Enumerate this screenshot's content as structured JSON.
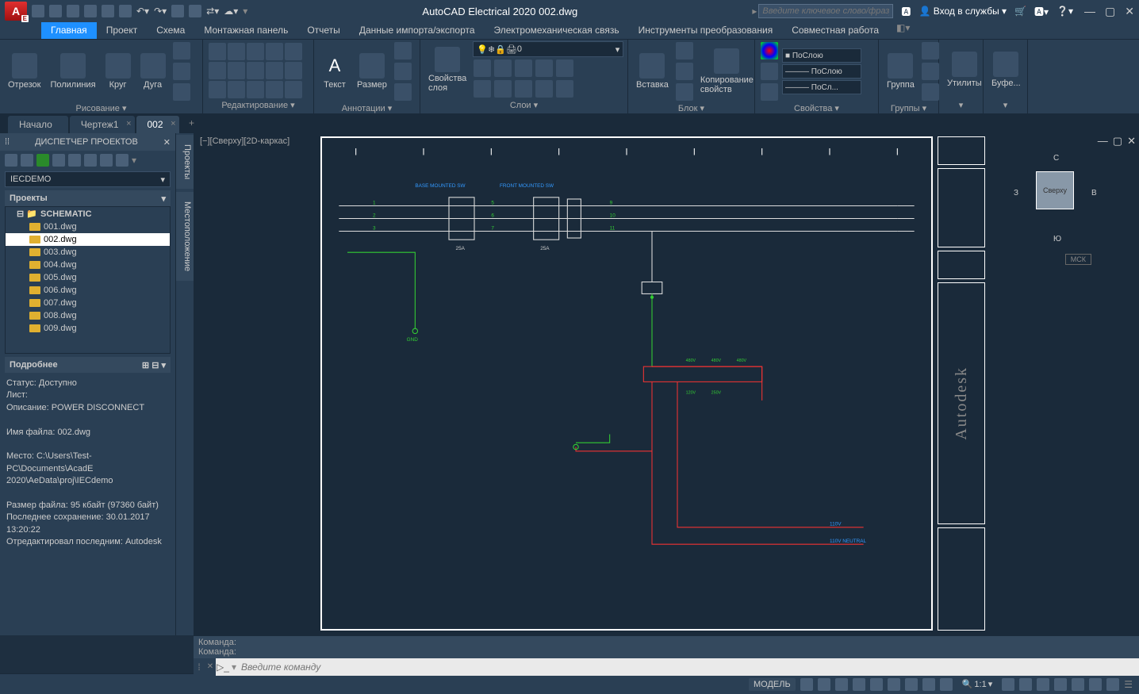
{
  "title": "AutoCAD Electrical 2020   002.dwg",
  "search_placeholder": "Введите ключевое слово/фразу",
  "signin": "Вход в службы",
  "ribbon_tabs": [
    "Главная",
    "Проект",
    "Схема",
    "Монтажная панель",
    "Отчеты",
    "Данные импорта/экспорта",
    "Электромеханическая связь",
    "Инструменты преобразования",
    "Совместная работа"
  ],
  "ribbon": {
    "draw": {
      "label": "Рисование ▾",
      "items": [
        "Отрезок",
        "Полилиния",
        "Круг",
        "Дуга"
      ]
    },
    "modify": {
      "label": "Редактирование ▾"
    },
    "annot": {
      "label": "Аннотации ▾",
      "items": [
        "Текст",
        "Размер"
      ]
    },
    "layers": {
      "label": "Слои ▾",
      "props_btn": "Свойства\nслоя",
      "combo": "0"
    },
    "block": {
      "label": "Блок ▾",
      "items": [
        "Вставка",
        "Копирование\nсвойств"
      ]
    },
    "props": {
      "label": "Свойства ▾",
      "c1": "■ ПоСлою",
      "c2": "——— ПоСлою",
      "c3": "——— ПоСл..."
    },
    "groups": {
      "label": "Группы ▾",
      "item": "Группа"
    },
    "util": {
      "label": "Утилиты"
    },
    "clip": {
      "label": "Буфе..."
    }
  },
  "doc_tabs": [
    {
      "label": "Начало",
      "closable": false
    },
    {
      "label": "Чертеж1",
      "closable": true
    },
    {
      "label": "002",
      "closable": true,
      "active": true
    }
  ],
  "pm": {
    "title": "ДИСПЕТЧЕР ПРОЕКТОВ",
    "project": "IECDEMO",
    "section": "Проекты",
    "folder": "SCHEMATIC",
    "files": [
      "001.dwg",
      "002.dwg",
      "003.dwg",
      "004.dwg",
      "005.dwg",
      "006.dwg",
      "007.dwg",
      "008.dwg",
      "009.dwg"
    ],
    "active_file": "002.dwg"
  },
  "details": {
    "header": "Подробнее",
    "status": "Статус: Доступно",
    "sheet": "Лист:",
    "desc": "Описание: POWER DISCONNECT",
    "fname": "Имя файла: 002.dwg",
    "loc": "Место: C:\\Users\\Test-PC\\Documents\\AcadE 2020\\AeData\\proj\\IECdemo",
    "size": "Размер файла: 95 кбайт (97360 байт)",
    "saved": "Последнее сохранение: 30.01.2017 13:20:22",
    "editor": "Отредактировал последним: Autodesk"
  },
  "vtabs": [
    "Проекты",
    "Местоположение"
  ],
  "view_label": "[−][Сверху][2D-каркас]",
  "viewcube": {
    "top": "Сверху",
    "n": "С",
    "s": "Ю",
    "e": "В",
    "w": "З"
  },
  "wcs": "МСК",
  "autodesk": "Autodesk",
  "schematic": {
    "sw1": "BASE MOUNTED SW",
    "sw2": "FRONT MOUNTED SW",
    "amps": "25A",
    "gnd": "GND",
    "neutral": "110V NEUTRAL",
    "v110": "110V"
  },
  "cmd": {
    "hist1": "Команда:",
    "hist2": "Команда:",
    "placeholder": "Введите команду"
  },
  "status": {
    "model": "МОДЕЛЬ",
    "scale": "1:1"
  }
}
